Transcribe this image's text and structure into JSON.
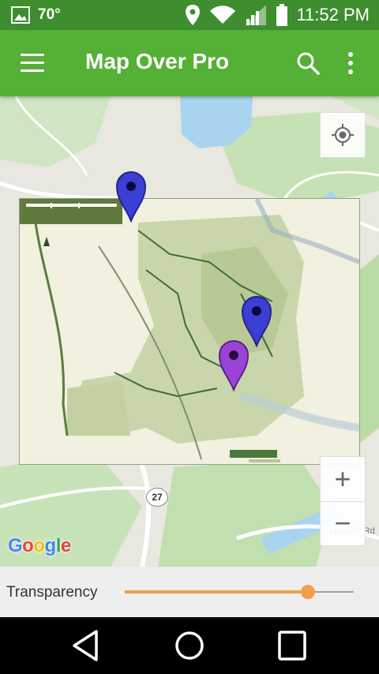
{
  "status_bar": {
    "temperature": "70°",
    "time": "11:52 PM",
    "icons": [
      "image-icon",
      "location-icon",
      "wifi-icon",
      "signal-icon",
      "battery-icon"
    ]
  },
  "toolbar": {
    "title": "Map Over Pro",
    "icons": [
      "menu-icon",
      "search-icon",
      "more-vert-icon"
    ]
  },
  "map": {
    "overlay_legend_title": "LEGEND",
    "route_shield": "27",
    "road_label": "Hospital Rd",
    "google_logo": "Google",
    "zoom_in": "+",
    "zoom_out": "−",
    "markers": [
      {
        "name": "marker-blue-top",
        "color": "#3b3fd6"
      },
      {
        "name": "marker-blue-middle",
        "color": "#3b3fd6"
      },
      {
        "name": "marker-purple",
        "color": "#9a44d6"
      }
    ]
  },
  "bottom_panel": {
    "transparency_label": "Transparency",
    "transparency_value": 0.8
  },
  "colors": {
    "status_bar": "#3e8e2f",
    "toolbar": "#55b036",
    "slider_accent": "#f0a04b"
  },
  "nav_bar": {
    "icons": [
      "back-icon",
      "home-icon",
      "recents-icon"
    ]
  }
}
